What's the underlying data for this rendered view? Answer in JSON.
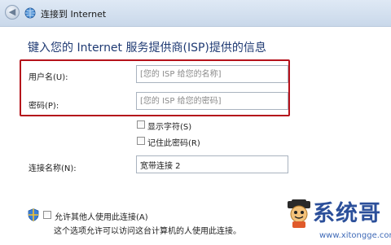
{
  "window": {
    "title": "连接到 Internet",
    "back_arrow": "◀",
    "icons": {
      "back": "back-arrow-icon",
      "globe": "network-globe-icon"
    }
  },
  "heading": "键入您的 Internet 服务提供商(ISP)提供的信息",
  "form": {
    "username_label": "用户名(U):",
    "username_placeholder": "[您的 ISP 给您的名称]",
    "password_label": "密码(P):",
    "password_placeholder": "[您的 ISP 给您的密码]",
    "show_chars_label": "显示字符(S)",
    "remember_password_label": "记住此密码(R)",
    "connection_name_label": "连接名称(N):",
    "connection_name_value": "宽带连接 2",
    "allow_others_label": "允许其他人使用此连接(A)",
    "allow_others_note": "这个选项允许可以访问这台计算机的人使用此连接。"
  },
  "watermark": {
    "text": "系统哥",
    "url": "www.xitongge.com"
  },
  "colors": {
    "highlight": "#b5121b",
    "heading": "#1f3a73",
    "watermark": "#2b4f9a"
  }
}
